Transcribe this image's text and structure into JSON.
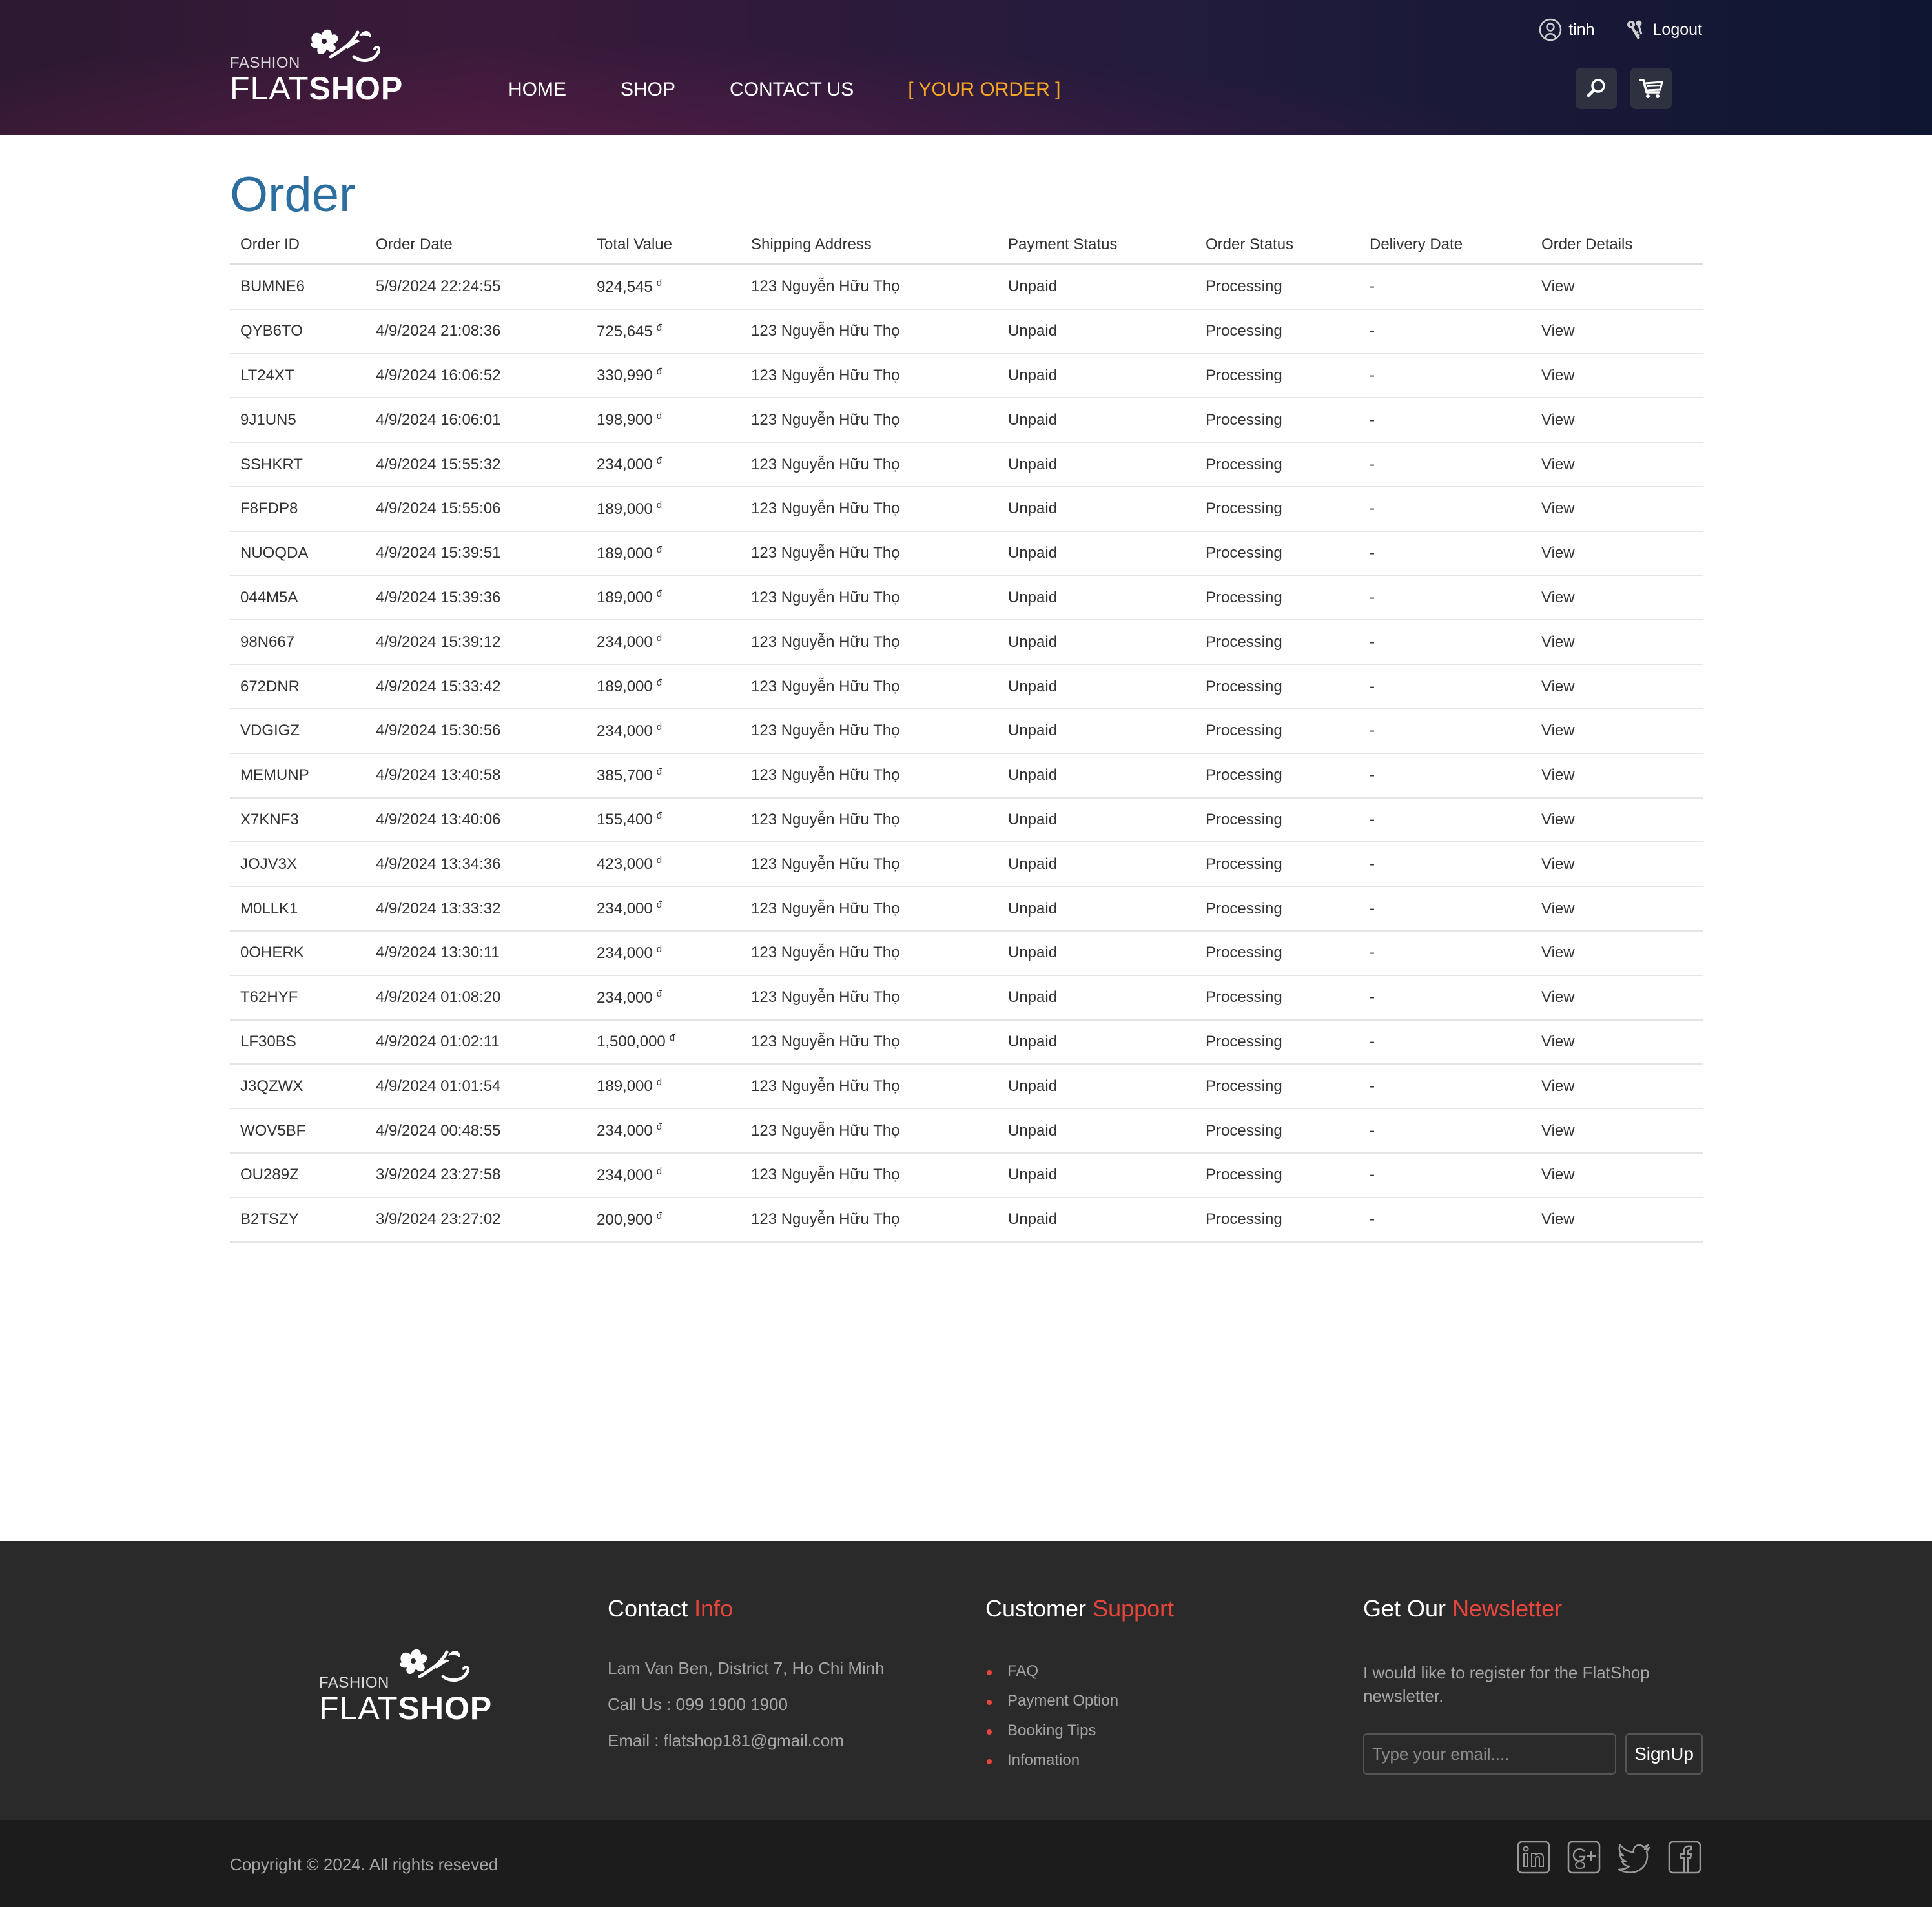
{
  "brand": {
    "tagline": "FASHION",
    "name_light": "FLAT",
    "name_bold": "SHOP"
  },
  "nav": {
    "home": "HOME",
    "shop": "SHOP",
    "contact": "CONTACT US",
    "your_order": "[ YOUR ORDER ]"
  },
  "user": {
    "name": "tinh",
    "logout": "Logout"
  },
  "page": {
    "title": "Order"
  },
  "table": {
    "headers": [
      "Order ID",
      "Order Date",
      "Total Value",
      "Shipping Address",
      "Payment Status",
      "Order Status",
      "Delivery Date",
      "Order Details"
    ],
    "currency": "đ",
    "rows": [
      {
        "id": "BUMNE6",
        "date": "5/9/2024 22:24:55",
        "total": "924,545",
        "address": "123 Nguyễn Hữu Thọ",
        "payment": "Unpaid",
        "status": "Processing",
        "delivery": "-",
        "details": "View"
      },
      {
        "id": "QYB6TO",
        "date": "4/9/2024 21:08:36",
        "total": "725,645",
        "address": "123 Nguyễn Hữu Thọ",
        "payment": "Unpaid",
        "status": "Processing",
        "delivery": "-",
        "details": "View"
      },
      {
        "id": "LT24XT",
        "date": "4/9/2024 16:06:52",
        "total": "330,990",
        "address": "123 Nguyễn Hữu Thọ",
        "payment": "Unpaid",
        "status": "Processing",
        "delivery": "-",
        "details": "View"
      },
      {
        "id": "9J1UN5",
        "date": "4/9/2024 16:06:01",
        "total": "198,900",
        "address": "123 Nguyễn Hữu Thọ",
        "payment": "Unpaid",
        "status": "Processing",
        "delivery": "-",
        "details": "View"
      },
      {
        "id": "SSHKRT",
        "date": "4/9/2024 15:55:32",
        "total": "234,000",
        "address": "123 Nguyễn Hữu Thọ",
        "payment": "Unpaid",
        "status": "Processing",
        "delivery": "-",
        "details": "View"
      },
      {
        "id": "F8FDP8",
        "date": "4/9/2024 15:55:06",
        "total": "189,000",
        "address": "123 Nguyễn Hữu Thọ",
        "payment": "Unpaid",
        "status": "Processing",
        "delivery": "-",
        "details": "View"
      },
      {
        "id": "NUOQDA",
        "date": "4/9/2024 15:39:51",
        "total": "189,000",
        "address": "123 Nguyễn Hữu Thọ",
        "payment": "Unpaid",
        "status": "Processing",
        "delivery": "-",
        "details": "View"
      },
      {
        "id": "044M5A",
        "date": "4/9/2024 15:39:36",
        "total": "189,000",
        "address": "123 Nguyễn Hữu Thọ",
        "payment": "Unpaid",
        "status": "Processing",
        "delivery": "-",
        "details": "View"
      },
      {
        "id": "98N667",
        "date": "4/9/2024 15:39:12",
        "total": "234,000",
        "address": "123 Nguyễn Hữu Thọ",
        "payment": "Unpaid",
        "status": "Processing",
        "delivery": "-",
        "details": "View"
      },
      {
        "id": "672DNR",
        "date": "4/9/2024 15:33:42",
        "total": "189,000",
        "address": "123 Nguyễn Hữu Thọ",
        "payment": "Unpaid",
        "status": "Processing",
        "delivery": "-",
        "details": "View"
      },
      {
        "id": "VDGIGZ",
        "date": "4/9/2024 15:30:56",
        "total": "234,000",
        "address": "123 Nguyễn Hữu Thọ",
        "payment": "Unpaid",
        "status": "Processing",
        "delivery": "-",
        "details": "View"
      },
      {
        "id": "MEMUNP",
        "date": "4/9/2024 13:40:58",
        "total": "385,700",
        "address": "123 Nguyễn Hữu Thọ",
        "payment": "Unpaid",
        "status": "Processing",
        "delivery": "-",
        "details": "View"
      },
      {
        "id": "X7KNF3",
        "date": "4/9/2024 13:40:06",
        "total": "155,400",
        "address": "123 Nguyễn Hữu Thọ",
        "payment": "Unpaid",
        "status": "Processing",
        "delivery": "-",
        "details": "View"
      },
      {
        "id": "JOJV3X",
        "date": "4/9/2024 13:34:36",
        "total": "423,000",
        "address": "123 Nguyễn Hữu Thọ",
        "payment": "Unpaid",
        "status": "Processing",
        "delivery": "-",
        "details": "View"
      },
      {
        "id": "M0LLK1",
        "date": "4/9/2024 13:33:32",
        "total": "234,000",
        "address": "123 Nguyễn Hữu Thọ",
        "payment": "Unpaid",
        "status": "Processing",
        "delivery": "-",
        "details": "View"
      },
      {
        "id": "0OHERK",
        "date": "4/9/2024 13:30:11",
        "total": "234,000",
        "address": "123 Nguyễn Hữu Thọ",
        "payment": "Unpaid",
        "status": "Processing",
        "delivery": "-",
        "details": "View"
      },
      {
        "id": "T62HYF",
        "date": "4/9/2024 01:08:20",
        "total": "234,000",
        "address": "123 Nguyễn Hữu Thọ",
        "payment": "Unpaid",
        "status": "Processing",
        "delivery": "-",
        "details": "View"
      },
      {
        "id": "LF30BS",
        "date": "4/9/2024 01:02:11",
        "total": "1,500,000",
        "address": "123 Nguyễn Hữu Thọ",
        "payment": "Unpaid",
        "status": "Processing",
        "delivery": "-",
        "details": "View"
      },
      {
        "id": "J3QZWX",
        "date": "4/9/2024 01:01:54",
        "total": "189,000",
        "address": "123 Nguyễn Hữu Thọ",
        "payment": "Unpaid",
        "status": "Processing",
        "delivery": "-",
        "details": "View"
      },
      {
        "id": "WOV5BF",
        "date": "4/9/2024 00:48:55",
        "total": "234,000",
        "address": "123 Nguyễn Hữu Thọ",
        "payment": "Unpaid",
        "status": "Processing",
        "delivery": "-",
        "details": "View"
      },
      {
        "id": "OU289Z",
        "date": "3/9/2024 23:27:58",
        "total": "234,000",
        "address": "123 Nguyễn Hữu Thọ",
        "payment": "Unpaid",
        "status": "Processing",
        "delivery": "-",
        "details": "View"
      },
      {
        "id": "B2TSZY",
        "date": "3/9/2024 23:27:02",
        "total": "200,900",
        "address": "123 Nguyễn Hữu Thọ",
        "payment": "Unpaid",
        "status": "Processing",
        "delivery": "-",
        "details": "View"
      }
    ]
  },
  "footer": {
    "contact": {
      "title": "Contact",
      "title_hl": "Info",
      "address": "Lam Van Ben, District 7, Ho Chi Minh",
      "phone": "Call Us : 099 1900 1900",
      "email": "Email : flatshop181@gmail.com"
    },
    "support": {
      "title": "Customer",
      "title_hl": "Support",
      "items": [
        "FAQ",
        "Payment Option",
        "Booking Tips",
        "Infomation"
      ]
    },
    "newsletter": {
      "title": "Get Our",
      "title_hl": "Newsletter",
      "text": "I would like to register for the FlatShop newsletter.",
      "placeholder": "Type your email....",
      "button": "SignUp"
    },
    "copyright": "Copyright © 2024. All rights reseved",
    "social": [
      "linkedin-icon",
      "google-plus-icon",
      "twitter-icon",
      "facebook-icon"
    ]
  },
  "colors": {
    "accent": "#f5a623",
    "title_blue": "#2c6e9e",
    "footer_highlight": "#e8453c",
    "footer_bg": "#2a2a2a",
    "bottom_bar_bg": "#1c1c1c"
  }
}
